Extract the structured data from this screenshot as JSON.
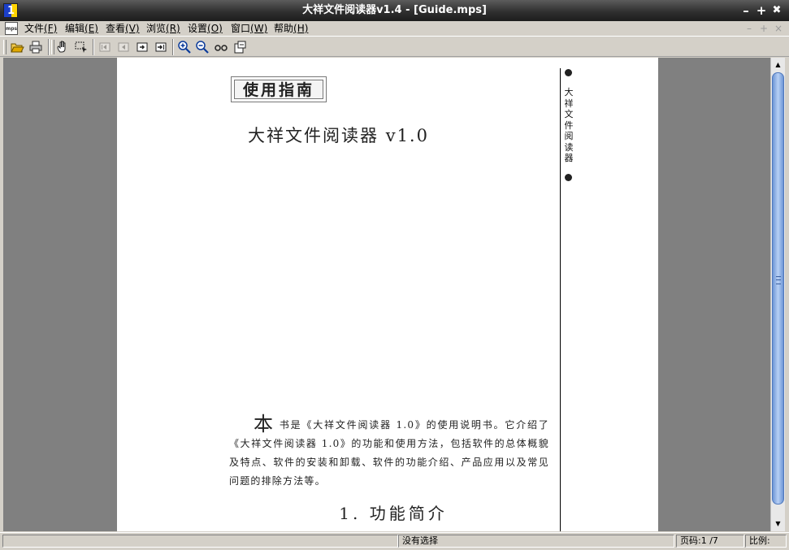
{
  "window": {
    "title": "大祥文件阅读器v1.4 - [Guide.mps]",
    "min_glyph": "–",
    "max_glyph": "+",
    "close_glyph": "✖"
  },
  "menubar": {
    "doc_icon_text": "mps",
    "items": [
      {
        "label": "文件",
        "accel": "(F)"
      },
      {
        "label": "编辑",
        "accel": "(E)"
      },
      {
        "label": "查看",
        "accel": "(V)"
      },
      {
        "label": "浏览",
        "accel": "(R)"
      },
      {
        "label": "设置",
        "accel": "(O)"
      },
      {
        "label": "窗口",
        "accel": "(W)"
      },
      {
        "label": "帮助",
        "accel": "(H)"
      }
    ],
    "mdi_min": "–",
    "mdi_max": "+",
    "mdi_close": "×"
  },
  "toolbar": {
    "buttons": [
      "open-folder-icon",
      "print-icon",
      "hand-tool-icon",
      "select-tool-icon",
      "first-page-icon",
      "prev-page-icon",
      "next-page-icon",
      "last-page-icon",
      "zoom-in-icon",
      "zoom-out-icon",
      "actual-size-icon",
      "fit-page-icon"
    ]
  },
  "document": {
    "guide_label": "使用指南",
    "main_title": "大祥文件阅读器 v1.0",
    "drop_cap": "本",
    "body_text": "书是《大祥文件阅读器 1.0》的使用说明书。它介绍了《大祥文件阅读器 1.0》的功能和使用方法，包括软件的总体概貌及特点、软件的安装和卸载、软件的功能介绍、产品应用以及常见问题的排除方法等。",
    "section_title": "1. 功能简介",
    "side_text": "大祥文件阅读器"
  },
  "scrollbar": {
    "up_arrow": "▲",
    "down_arrow": "▼",
    "position": 0.0
  },
  "statusbar": {
    "selection": "没有选择",
    "page": "页码:1 /7",
    "zoom": "比例:"
  },
  "colors": {
    "title_bar": "#303030",
    "chrome": "#d4d0c8",
    "workspace": "#808080",
    "scroll_thumb": "#8fb0e6"
  }
}
